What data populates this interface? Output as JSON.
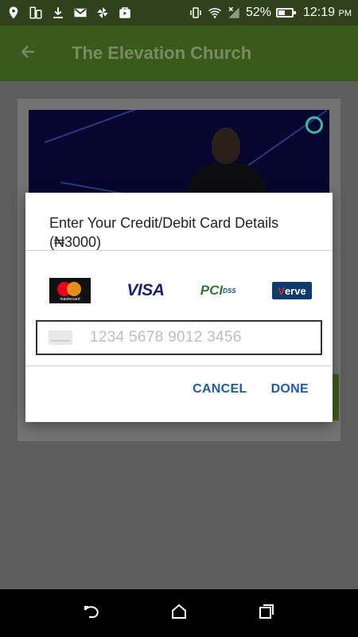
{
  "status_bar": {
    "battery": "52%",
    "battery_level": 0.52,
    "time": "12:19",
    "ampm": "PM"
  },
  "app_bar": {
    "title": "The Elevation Church",
    "back_icon": "arrow-left-icon"
  },
  "dialog": {
    "title": "Enter Your Credit/Debit Card Details (₦3000)",
    "logos": {
      "mastercard_text": "mastercard",
      "visa": "VISA",
      "pci": "PCI",
      "dss": "DSS",
      "verve_v": "V",
      "verve_rest": "erve"
    },
    "card_input": {
      "placeholder": "1234 5678 9012 3456",
      "value": ""
    },
    "actions": {
      "cancel": "CANCEL",
      "done": "DONE"
    }
  },
  "nav_bar": {
    "icons": [
      "back-icon",
      "home-icon",
      "recents-icon"
    ]
  },
  "colors": {
    "app_bar": "#3a5a1c",
    "status_bar": "#2f421c",
    "dialog_button": "#1c5da7",
    "dim": "#5e5e5e"
  }
}
